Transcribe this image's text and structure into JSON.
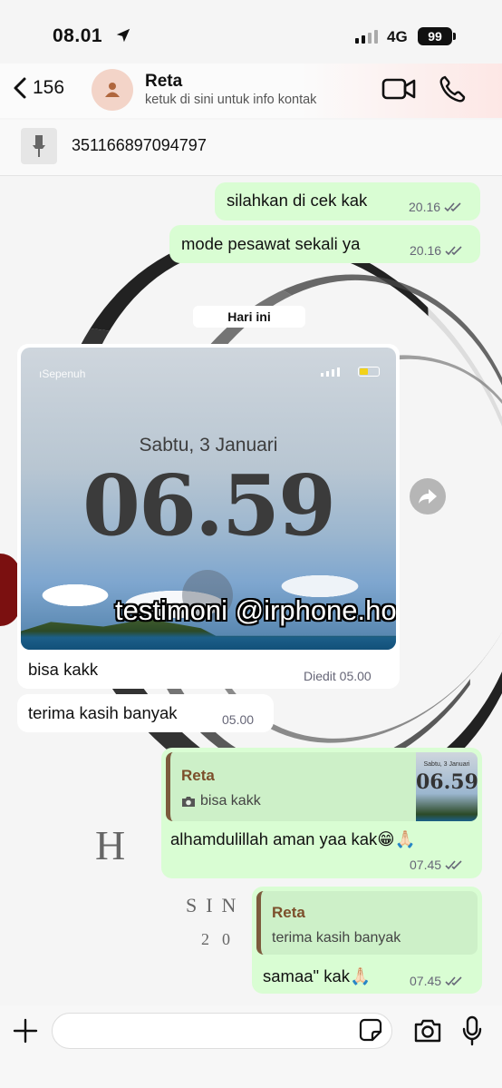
{
  "status_bar": {
    "time": "08.01",
    "network": "4G",
    "battery": "99"
  },
  "header": {
    "back_count": "156",
    "contact_name": "Reta",
    "subtitle": "ketuk di sini untuk info kontak",
    "accent_color": "#fde7e5"
  },
  "pinned": {
    "text": "351166897094797"
  },
  "date_chip": "Hari ini",
  "messages": {
    "m1": {
      "text": "silahkan di cek kak",
      "time": "20.16"
    },
    "m2": {
      "text": "mode pesawat sekali ya",
      "time": "20.16"
    },
    "img": {
      "lock_carrier": "ıSepenuh",
      "lock_date": "Sabtu, 3 Januari",
      "lock_time": "06.59",
      "overlay": "testimoni @irphone.house",
      "caption": "bisa kakk",
      "meta": "Diedit 05.00"
    },
    "m3": {
      "text": "terima kasih banyak",
      "time": "05.00"
    },
    "m4": {
      "quote_name": "Reta",
      "quote_text": "bisa kakk",
      "thumb_date": "Sabtu, 3 Januari",
      "thumb_time": "06.59",
      "text": "alhamdulillah aman yaa kak😁🙏🏻",
      "time": "07.45"
    },
    "m5": {
      "quote_name": "Reta",
      "quote_text": "terima kasih banyak",
      "text": "samaa\" kak🙏🏻",
      "time": "07.45"
    }
  },
  "wallpaper": {
    "letter": "H",
    "word": "SIN",
    "year": "20"
  },
  "colors": {
    "outgoing_bubble": "#d9fdd3",
    "incoming_bubble": "#ffffff",
    "quote_accent": "#7c5a3c"
  },
  "icons": [
    "chevron-left-icon",
    "person-icon",
    "video-call-icon",
    "phone-icon",
    "pin-icon",
    "read-ticks-icon",
    "forward-icon",
    "camera-icon",
    "plus-icon",
    "sticker-icon",
    "mic-icon",
    "location-arrow-icon"
  ]
}
